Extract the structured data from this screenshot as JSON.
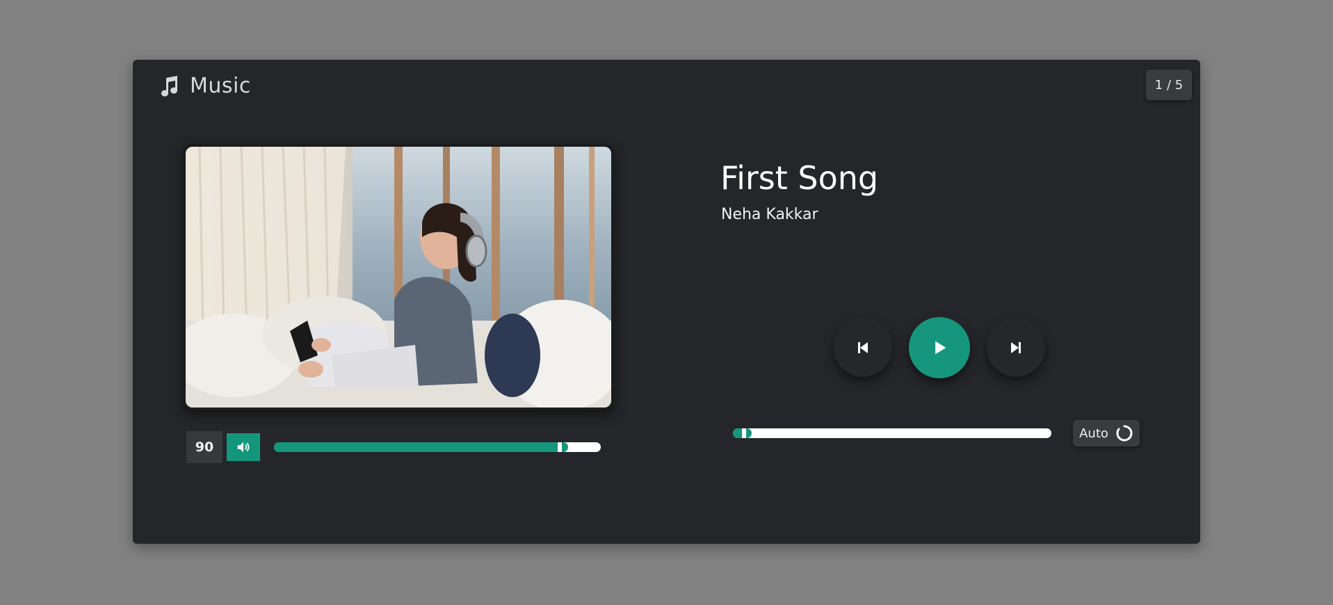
{
  "app": {
    "title": "Music",
    "icon": "music-note-icon"
  },
  "counter": {
    "text": "1 / 5"
  },
  "cover": {
    "icon": "cover-art-image"
  },
  "volume": {
    "value": "90",
    "level": 0.9,
    "icon": "speaker-icon"
  },
  "song": {
    "title": "First Song",
    "artist": "Neha Kakkar"
  },
  "controls": {
    "prev_icon": "skip-previous-icon",
    "play_icon": "play-icon",
    "next_icon": "skip-next-icon"
  },
  "progress": {
    "level": 0.06
  },
  "auto": {
    "label": "Auto",
    "icon": "repeat-circle-icon"
  },
  "colors": {
    "accent": "#14967c",
    "panel": "#252629",
    "backdrop": "#828282"
  }
}
